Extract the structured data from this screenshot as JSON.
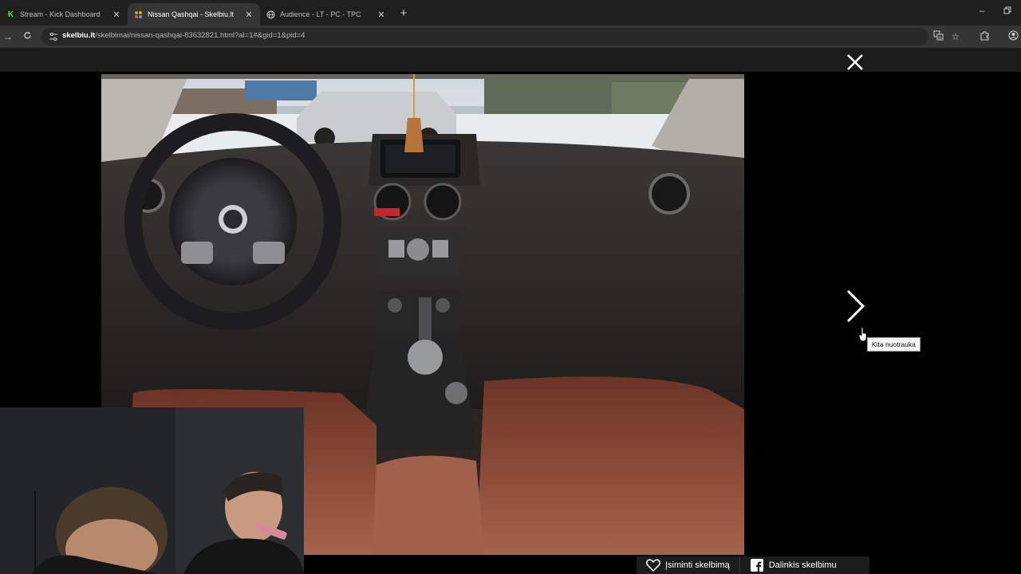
{
  "browser": {
    "tabs": [
      {
        "title": "Stream - Kick Dashboard",
        "favicon": "kick-icon",
        "color": "#53fc18",
        "active": false
      },
      {
        "title": "Nissan Qashqai - Skelbiu.lt",
        "favicon": "skelbiu-icon",
        "color": "#7cc242",
        "active": true
      },
      {
        "title": "Audience - LT - PC - TPC",
        "favicon": "globe-icon",
        "color": "#cfcfcf",
        "active": false
      }
    ],
    "url": {
      "host": "skelbiu.lt",
      "path": "/skelbimai/nissan-qashqai-83632821.html?al=1#&gid=1&pid=4"
    }
  },
  "viewer": {
    "tooltip": "Kita nuotrauka",
    "actions": {
      "save_label": "Įsiminti skelbimą",
      "share_label": "Dalinkis skelbimu"
    }
  },
  "colors": {
    "accent_kick": "#53fc18",
    "leather": "#7a3d2c",
    "backdrop": "#000000"
  }
}
